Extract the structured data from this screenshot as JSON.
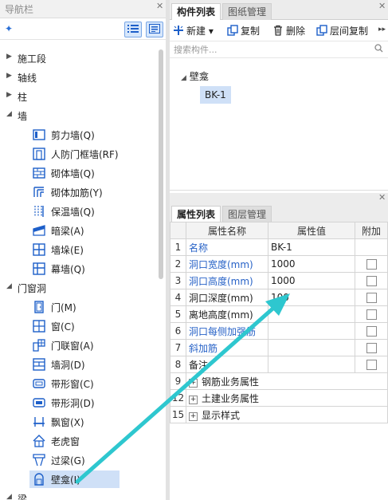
{
  "nav": {
    "title": "导航栏",
    "categories": [
      {
        "label": "施工段",
        "expanded": false
      },
      {
        "label": "轴线",
        "expanded": false
      },
      {
        "label": "柱",
        "expanded": false
      },
      {
        "label": "墙",
        "expanded": true,
        "items": [
          {
            "label": "剪力墙(Q)",
            "icon": "shear-wall-icon"
          },
          {
            "label": "人防门框墙(RF)",
            "icon": "civil-defense-door-wall-icon"
          },
          {
            "label": "砌体墙(Q)",
            "icon": "masonry-wall-icon"
          },
          {
            "label": "砌体加筋(Y)",
            "icon": "masonry-reinforcement-icon"
          },
          {
            "label": "保温墙(Q)",
            "icon": "insulation-wall-icon"
          },
          {
            "label": "暗梁(A)",
            "icon": "hidden-beam-icon"
          },
          {
            "label": "墙垛(E)",
            "icon": "wall-pier-icon"
          },
          {
            "label": "幕墙(Q)",
            "icon": "curtain-wall-icon"
          }
        ]
      },
      {
        "label": "门窗洞",
        "expanded": true,
        "items": [
          {
            "label": "门(M)",
            "icon": "door-icon"
          },
          {
            "label": "窗(C)",
            "icon": "window-icon"
          },
          {
            "label": "门联窗(A)",
            "icon": "door-window-icon"
          },
          {
            "label": "墙洞(D)",
            "icon": "wall-opening-icon"
          },
          {
            "label": "带形窗(C)",
            "icon": "strip-window-icon"
          },
          {
            "label": "带形洞(D)",
            "icon": "strip-opening-icon"
          },
          {
            "label": "飘窗(X)",
            "icon": "bay-window-icon"
          },
          {
            "label": "老虎窗",
            "icon": "dormer-window-icon"
          },
          {
            "label": "过梁(G)",
            "icon": "lintel-icon"
          },
          {
            "label": "壁龛(I)",
            "icon": "niche-icon",
            "selected": true
          }
        ]
      },
      {
        "label": "梁",
        "expanded": true
      }
    ]
  },
  "component_panel": {
    "tabs": [
      "构件列表",
      "图纸管理"
    ],
    "active_tab": 0,
    "toolbar": {
      "new_label": "新建",
      "copy_label": "复制",
      "delete_label": "删除",
      "floor_copy_label": "层间复制",
      "more_label": "▸▸"
    },
    "search_placeholder": "搜索构件...",
    "tree": {
      "group": "壁龛",
      "items": [
        "BK-1"
      ]
    }
  },
  "property_panel": {
    "tabs": [
      "属性列表",
      "图层管理"
    ],
    "active_tab": 0,
    "headers": [
      "属性名称",
      "属性值",
      "附加"
    ],
    "rows": [
      {
        "no": "1",
        "name": "名称",
        "value": "BK-1",
        "blue": true,
        "checkbox": false
      },
      {
        "no": "2",
        "name": "洞口宽度(mm)",
        "value": "1000",
        "blue": true,
        "checkbox": true
      },
      {
        "no": "3",
        "name": "洞口高度(mm)",
        "value": "1000",
        "blue": true,
        "checkbox": true
      },
      {
        "no": "4",
        "name": "洞口深度(mm)",
        "value": "100",
        "blue": false,
        "checkbox": true
      },
      {
        "no": "5",
        "name": "离地高度(mm)",
        "value": "",
        "blue": false,
        "checkbox": true
      },
      {
        "no": "6",
        "name": "洞口每侧加强筋",
        "value": "",
        "blue": true,
        "checkbox": true
      },
      {
        "no": "7",
        "name": "斜加筋",
        "value": "",
        "blue": true,
        "checkbox": true
      },
      {
        "no": "8",
        "name": "备注",
        "value": "",
        "blue": false,
        "checkbox": true
      },
      {
        "no": "9",
        "name": "钢筋业务属性",
        "value": "",
        "blue": false,
        "group": true
      },
      {
        "no": "12",
        "name": "土建业务属性",
        "value": "",
        "blue": false,
        "group": true
      },
      {
        "no": "15",
        "name": "显示样式",
        "value": "",
        "blue": false,
        "group": true
      }
    ]
  },
  "colors": {
    "accent": "#2762c7",
    "selection": "#cfe0f7",
    "annotation_arrow": "#2ec7cf"
  }
}
